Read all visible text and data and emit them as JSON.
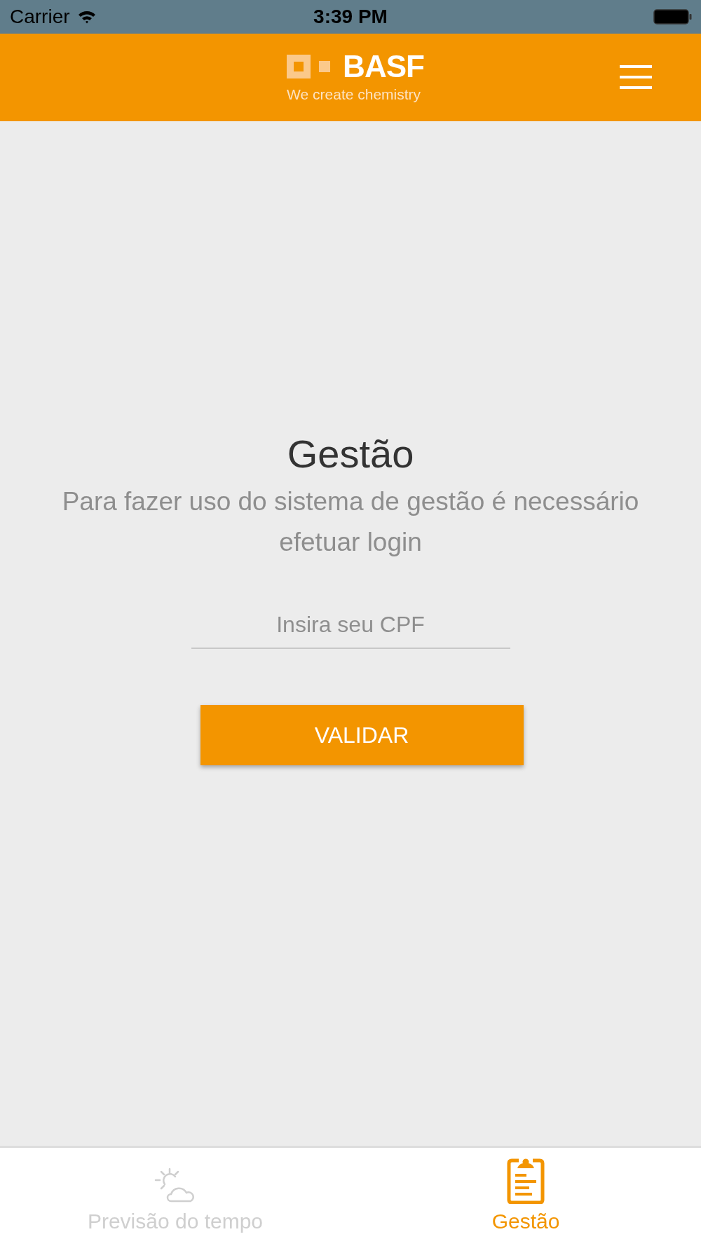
{
  "status_bar": {
    "carrier": "Carrier",
    "time": "3:39 PM"
  },
  "header": {
    "logo_wordmark": "BASF",
    "logo_tagline": "We create chemistry"
  },
  "login": {
    "title": "Gestão",
    "message": "Para fazer uso do sistema de gestão é necessário efetuar login",
    "cpf_field": {
      "placeholder": "Insira seu CPF"
    },
    "button": "VALIDAR"
  },
  "tab_bar": [
    {
      "label": "Previsão do tempo",
      "kind": "weather",
      "selected": false
    },
    {
      "label": "Gestão",
      "kind": "clipboard",
      "selected": true
    }
  ]
}
